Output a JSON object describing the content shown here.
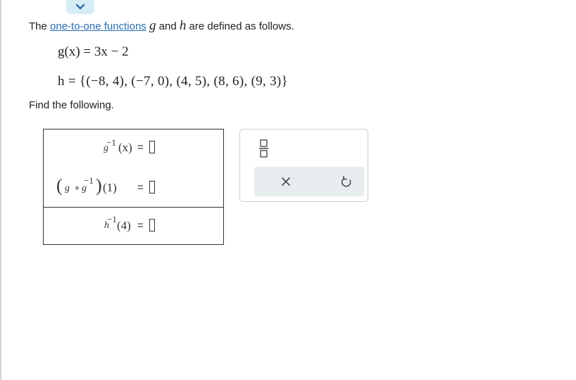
{
  "intro": {
    "prefix": "The",
    "link": "one-to-one functions",
    "var_g": "g",
    "and": "and",
    "var_h": "h",
    "suffix": "are defined as follows."
  },
  "equation_g": "g(x) = 3x − 2",
  "equation_h": "h = {(−8, 4), (−7, 0), (4, 5), (8, 6), (9, 3)}",
  "find_label": "Find the following.",
  "questions": [
    {
      "func": "g",
      "inv": "−1",
      "arg": "(x)",
      "eq": "="
    },
    {
      "lparen": "(",
      "g1": "g",
      "op": "∘",
      "g2": "g",
      "inv": "−1",
      "rparen": ")",
      "arg": "(1)",
      "eq": "="
    },
    {
      "func": "h",
      "inv": "−1",
      "arg": "(4)",
      "eq": "="
    }
  ],
  "toolbar": {
    "fraction_icon": "fraction-icon",
    "clear_icon": "close-icon",
    "undo_icon": "undo-icon",
    "clear_glyph": "×"
  },
  "colors": {
    "link": "#2a6fb0",
    "tab": "#d7edf6",
    "button_bar": "#e7ecef"
  }
}
